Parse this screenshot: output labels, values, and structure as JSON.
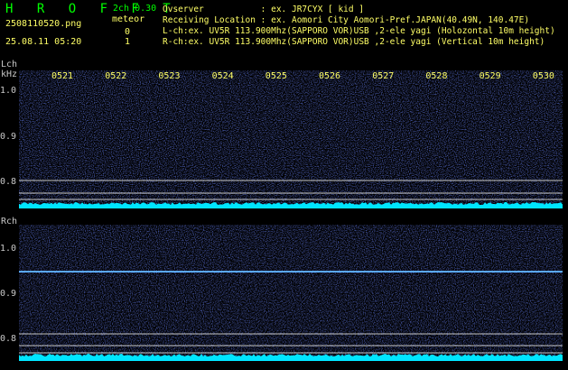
{
  "header": {
    "app_title": "H R O F F T",
    "version": "2ch 0.30",
    "count_label": "meteor",
    "filename": "2508110520.png",
    "timestamp": "25.08.11 05:20",
    "lch_count": "0",
    "rch_count": "1",
    "observer_line": "Ovserver           : ex. JR7CYX [ kid ]",
    "location_line": "Receiving Location : ex. Aomori City Aomori-Pref.JAPAN(40.49N, 140.47E)",
    "lch_line": "L-ch:ex. UV5R 113.900Mhz(SAPPORO VOR)USB ,2-ele yagi (Holozontal 10m height)",
    "rch_line": "R-ch:ex. UV5R 113.900Mhz(SAPPORO VOR)USB ,2-ele yagi (Vertical 10m height)"
  },
  "time_ticks": [
    "0521",
    "0522",
    "0523",
    "0524",
    "0525",
    "0526",
    "0527",
    "0528",
    "0529",
    "0530"
  ],
  "lch_panel": {
    "label": "Lch",
    "unit": "kHz",
    "y_ticks": [
      "1.0",
      "0.9",
      "0.8"
    ]
  },
  "rch_panel": {
    "label": "Rch",
    "y_ticks": [
      "1.0",
      "0.9",
      "0.8"
    ]
  },
  "colors": {
    "background": "#000000",
    "noise": "#1a2aa8",
    "baseline": "#00e5ff",
    "grid": "#c8c8c8",
    "signal": "#4aa0ff",
    "header_green": "#00ff00",
    "header_yellow": "#ffff66"
  }
}
